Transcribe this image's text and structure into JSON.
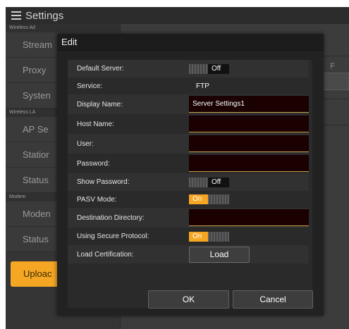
{
  "screen": {
    "title": "Settings",
    "nav": [
      {
        "type": "group",
        "label": "Wireless Ad"
      },
      {
        "type": "item",
        "label": "Stream"
      },
      {
        "type": "item",
        "label": "Proxy"
      },
      {
        "type": "item",
        "label": "Systen"
      },
      {
        "type": "group",
        "label": "Wireless LA"
      },
      {
        "type": "item",
        "label": "AP Se"
      },
      {
        "type": "item",
        "label": "Statior"
      },
      {
        "type": "item",
        "label": "Status"
      },
      {
        "type": "group",
        "label": "Modem"
      },
      {
        "type": "item",
        "label": "Moden"
      },
      {
        "type": "item",
        "label": "Status"
      }
    ],
    "upload_label": "Uploac",
    "select_fragment": "F"
  },
  "dialog": {
    "title": "Edit",
    "default_server": {
      "label": "Default Server:",
      "state": "Off"
    },
    "service": {
      "label": "Service:",
      "value": "FTP"
    },
    "display_name": {
      "label": "Display Name:",
      "value": "Server Settings1"
    },
    "host_name": {
      "label": "Host Name:",
      "value": ""
    },
    "user": {
      "label": "User:",
      "value": ""
    },
    "password": {
      "label": "Password:",
      "value": ""
    },
    "show_password": {
      "label": "Show Password:",
      "state": "Off"
    },
    "pasv_mode": {
      "label": "PASV Mode:",
      "state": "On"
    },
    "destination_directory": {
      "label": "Destination Directory:",
      "value": ""
    },
    "secure_protocol": {
      "label": "Using Secure Protocol:",
      "state": "On"
    },
    "load_certification": {
      "label": "Load Certification:",
      "button": "Load"
    },
    "ok_label": "OK",
    "cancel_label": "Cancel"
  },
  "colors": {
    "accent": "#f5a623",
    "input_bg": "#1a0000",
    "input_underline": "#c8a04a"
  }
}
